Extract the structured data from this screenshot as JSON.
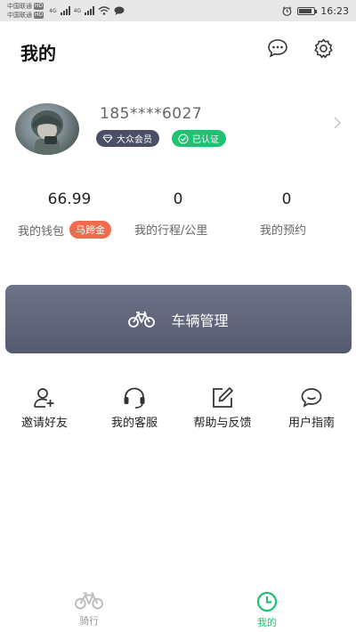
{
  "status_bar": {
    "carrier_1": "中国联通",
    "carrier_2": "中国联通",
    "hd": "HD",
    "network_1": "4G",
    "network_2": "4G",
    "time": "16:23"
  },
  "header": {
    "title": "我的",
    "message_icon": "chat-bubble-icon",
    "settings_icon": "gear-icon"
  },
  "profile": {
    "phone": "185****6027",
    "member_badge": "大众会员",
    "verified_badge": "已认证"
  },
  "stats": [
    {
      "value": "66.99",
      "label": "我的钱包",
      "tag": "马蹄金"
    },
    {
      "value": "0",
      "label": "我的行程/公里"
    },
    {
      "value": "0",
      "label": "我的预约"
    }
  ],
  "vehicle_management": {
    "label": "车辆管理",
    "icon": "bicycle-icon"
  },
  "quick_actions": [
    {
      "label": "邀请好友",
      "icon": "add-user-icon"
    },
    {
      "label": "我的客服",
      "icon": "headset-icon"
    },
    {
      "label": "帮助与反馈",
      "icon": "edit-icon"
    },
    {
      "label": "用户指南",
      "icon": "chat-icon"
    }
  ],
  "bottom_nav": {
    "tabs": [
      {
        "label": "骑行",
        "icon": "bicycle-icon",
        "active": false
      },
      {
        "label": "我的",
        "icon": "clock-icon",
        "active": true
      }
    ]
  },
  "colors": {
    "accent": "#1ec372",
    "vehicle_button": "#5d6177",
    "member_badge": "#4b4f66",
    "coin_tag": "#f26b4f"
  }
}
